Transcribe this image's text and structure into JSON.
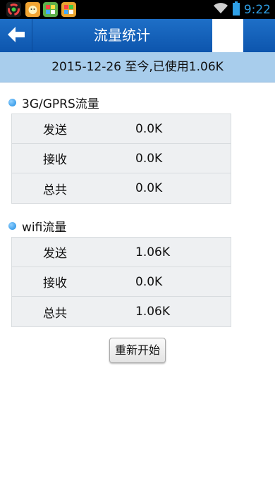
{
  "status_bar": {
    "time": "9:22",
    "app_icons": [
      "app-icon",
      "app-icon",
      "app-icon",
      "app-icon"
    ]
  },
  "header": {
    "title": "流量统计",
    "back_icon": "back-arrow-icon"
  },
  "info": {
    "text": "2015-12-26 至今,已使用1.06K"
  },
  "gprs": {
    "title": "3G/GPRS流量",
    "rows": [
      {
        "label": "发送",
        "value": "0.0K"
      },
      {
        "label": "接收",
        "value": "0.0K"
      },
      {
        "label": "总共",
        "value": "0.0K"
      }
    ]
  },
  "wifi": {
    "title": "wifi流量",
    "rows": [
      {
        "label": "发送",
        "value": "1.06K"
      },
      {
        "label": "接收",
        "value": "0.0K"
      },
      {
        "label": "总共",
        "value": "1.06K"
      }
    ]
  },
  "actions": {
    "reset_label": "重新开始"
  },
  "colors": {
    "header_bg": "#0d55ad",
    "info_bg": "#a8cdec",
    "accent": "#2fa0e6"
  }
}
